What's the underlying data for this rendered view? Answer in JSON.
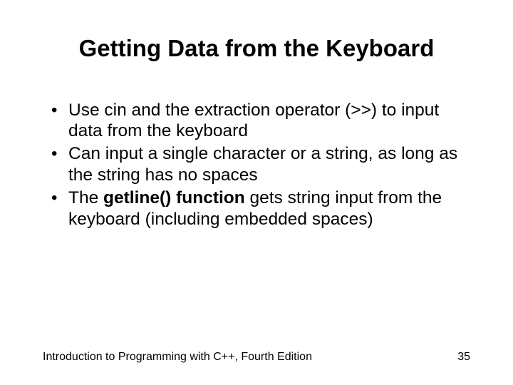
{
  "title": "Getting Data from the Keyboard",
  "bullets": [
    {
      "pre": "Use cin and the extraction operator (>>) to input data from the keyboard",
      "bold": "",
      "post": ""
    },
    {
      "pre": "Can input a single character or a string, as long as the string has no spaces",
      "bold": "",
      "post": ""
    },
    {
      "pre": "The ",
      "bold": "getline() function",
      "post": " gets string input from the keyboard (including embedded spaces)"
    }
  ],
  "footer": {
    "left": "Introduction to Programming with C++, Fourth Edition",
    "right": "35"
  }
}
